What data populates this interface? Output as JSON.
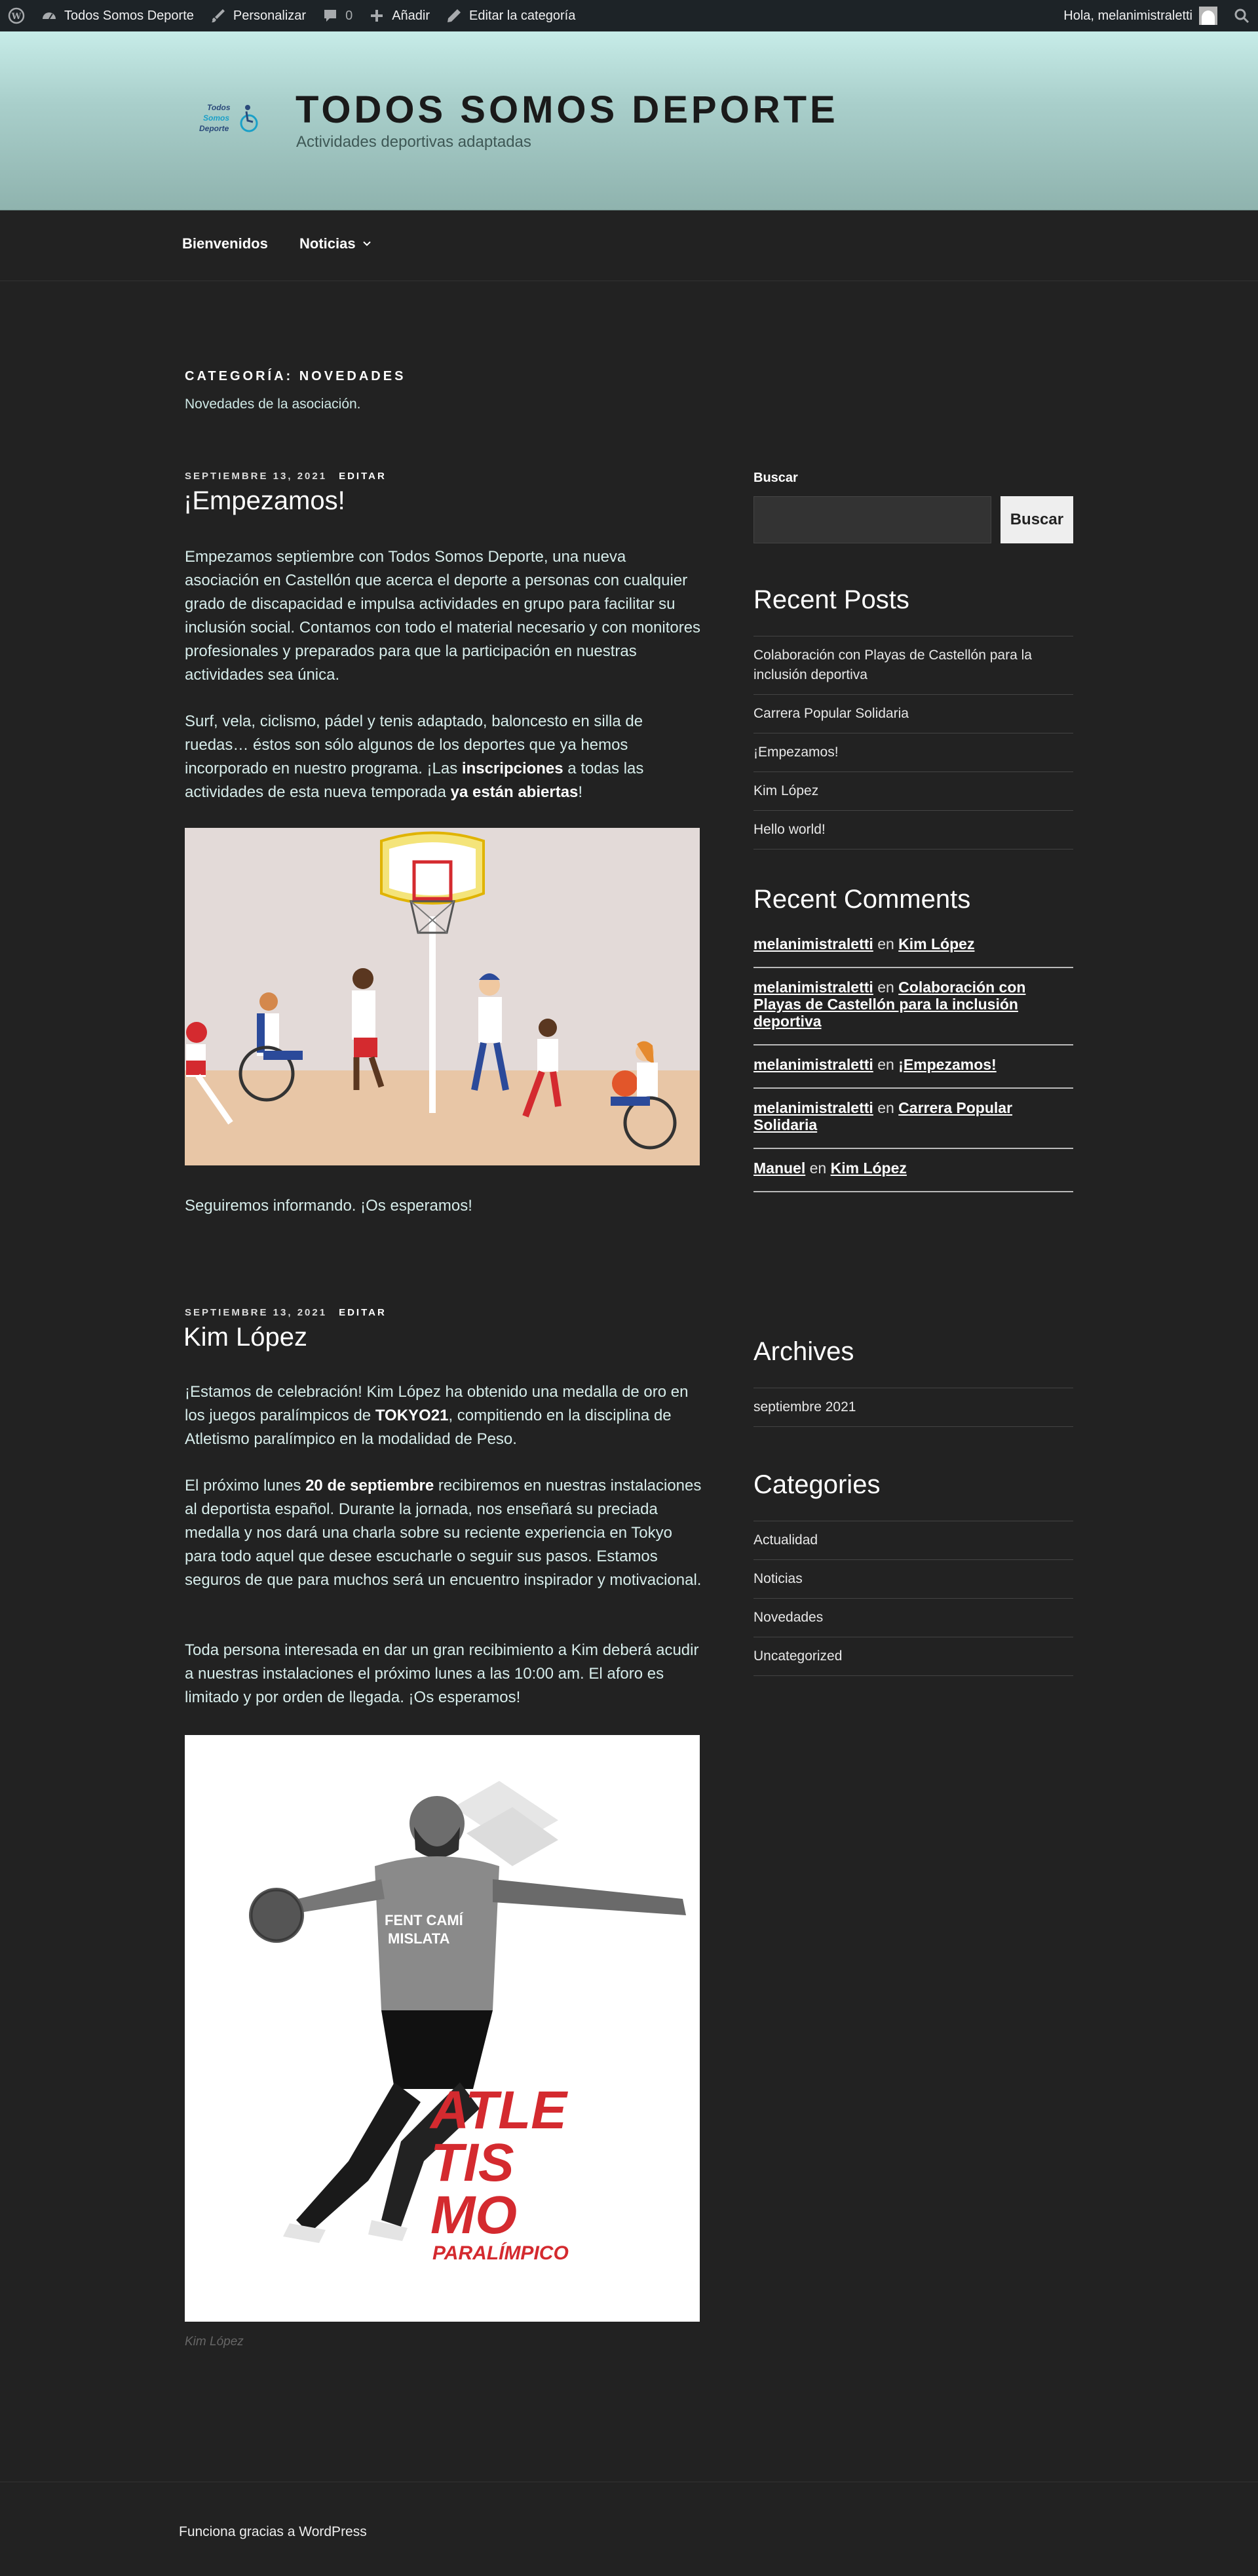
{
  "admin_bar": {
    "site_name": "Todos Somos Deporte",
    "customize": "Personalizar",
    "comments_count": "0",
    "add_new": "Añadir",
    "edit_category": "Editar la categoría",
    "greeting": "Hola, melanimistraletti"
  },
  "header": {
    "logo_lines": [
      "Todos",
      "Somos",
      "Deporte"
    ],
    "title": "TODOS SOMOS DEPORTE",
    "description": "Actividades deportivas adaptadas"
  },
  "nav": {
    "items": [
      {
        "label": "Bienvenidos"
      },
      {
        "label": "Noticias"
      }
    ]
  },
  "archive": {
    "title": "CATEGORÍA: NOVEDADES",
    "description": "Novedades de la asociación."
  },
  "posts": [
    {
      "date": "SEPTIEMBRE 13, 2021",
      "edit": "EDITAR",
      "title": "¡Empezamos!",
      "p1": "Empezamos septiembre con Todos Somos Deporte, una nueva asociación en Castellón que acerca el deporte a personas con cualquier grado de discapacidad e impulsa actividades en grupo para facilitar su inclusión social. Contamos con todo el material necesario y con monitores profesionales y preparados para que la participación en nuestras actividades sea única.",
      "p2_a": "Surf, vela, ciclismo, pádel y tenis adaptado, baloncesto en silla de ruedas…  éstos son sólo algunos de los deportes que ya hemos incorporado en nuestro programa. ¡Las ",
      "p2_b": "inscripciones",
      "p2_c": " a todas las actividades de esta nueva temporada ",
      "p2_d": "ya están abiertas",
      "p2_e": "!",
      "p3": "Seguiremos informando. ¡Os esperamos!"
    },
    {
      "date": "SEPTIEMBRE 13, 2021",
      "edit": "EDITAR",
      "title": "Kim López",
      "p1_a": "¡Estamos de celebración! Kim López ha obtenido una medalla de oro en los juegos paralímpicos de ",
      "p1_b": "TOKYO21",
      "p1_c": ", compitiendo en la disciplina de Atletismo paralímpico en la modalidad de Peso.",
      "p2_a": "El próximo lunes ",
      "p2_b": "20 de septiembre",
      "p2_c": " recibiremos en nuestras instalaciones al deportista español. Durante la jornada, nos enseñará su preciada medalla y nos dará una charla sobre su reciente experiencia en Tokyo para todo aquel que desee escucharle o seguir sus pasos. Estamos seguros de que para muchos será un encuentro inspirador y motivacional.",
      "p3": "Toda persona interesada en dar un gran recibimiento a Kim deberá acudir a nuestras instalaciones el próximo lunes a las 10:00 am. El aforo es limitado y por orden de llegada. ¡Os esperamos!",
      "poster_shirt": [
        "FENT CAMÍ",
        "MISLATA"
      ],
      "poster_lines": [
        "ATLE",
        "TIS",
        "MO"
      ],
      "poster_sub": "PARALÍMPICO",
      "caption": "Kim López"
    }
  ],
  "sidebar": {
    "search_label": "Buscar",
    "search_button": "Buscar",
    "recent_posts_title": "Recent Posts",
    "recent_posts": [
      "Colaboración con Playas de Castellón para la inclusión deportiva",
      "Carrera Popular Solidaria",
      "¡Empezamos!",
      "Kim López",
      "Hello world!"
    ],
    "recent_comments_title": "Recent Comments",
    "connector": "en",
    "recent_comments": [
      {
        "author": "melanimistraletti",
        "post": "Kim López"
      },
      {
        "author": "melanimistraletti",
        "post": "Colaboración con Playas de Castellón para la inclusión deportiva"
      },
      {
        "author": "melanimistraletti",
        "post": "¡Empezamos!"
      },
      {
        "author": "melanimistraletti",
        "post": "Carrera Popular Solidaria"
      },
      {
        "author": "Manuel",
        "post": "Kim López"
      }
    ],
    "archives_title": "Archives",
    "archives": [
      "septiembre 2021"
    ],
    "categories_title": "Categories",
    "categories": [
      "Actualidad",
      "Noticias",
      "Novedades",
      "Uncategorized"
    ]
  },
  "footer": {
    "text": "Funciona gracias a WordPress"
  },
  "colors": {
    "background": "#222222",
    "admin_bar": "#1d2327",
    "header_gradient_top": "#c7ece8",
    "header_gradient_bottom": "#8fb3ae",
    "body_text": "#d6ecea",
    "poster_red": "#d42a2f"
  },
  "icons": [
    "wordpress-icon",
    "dashboard-icon",
    "brush-icon",
    "comment-icon",
    "plus-icon",
    "pencil-icon",
    "search-icon",
    "chevron-down-icon"
  ]
}
